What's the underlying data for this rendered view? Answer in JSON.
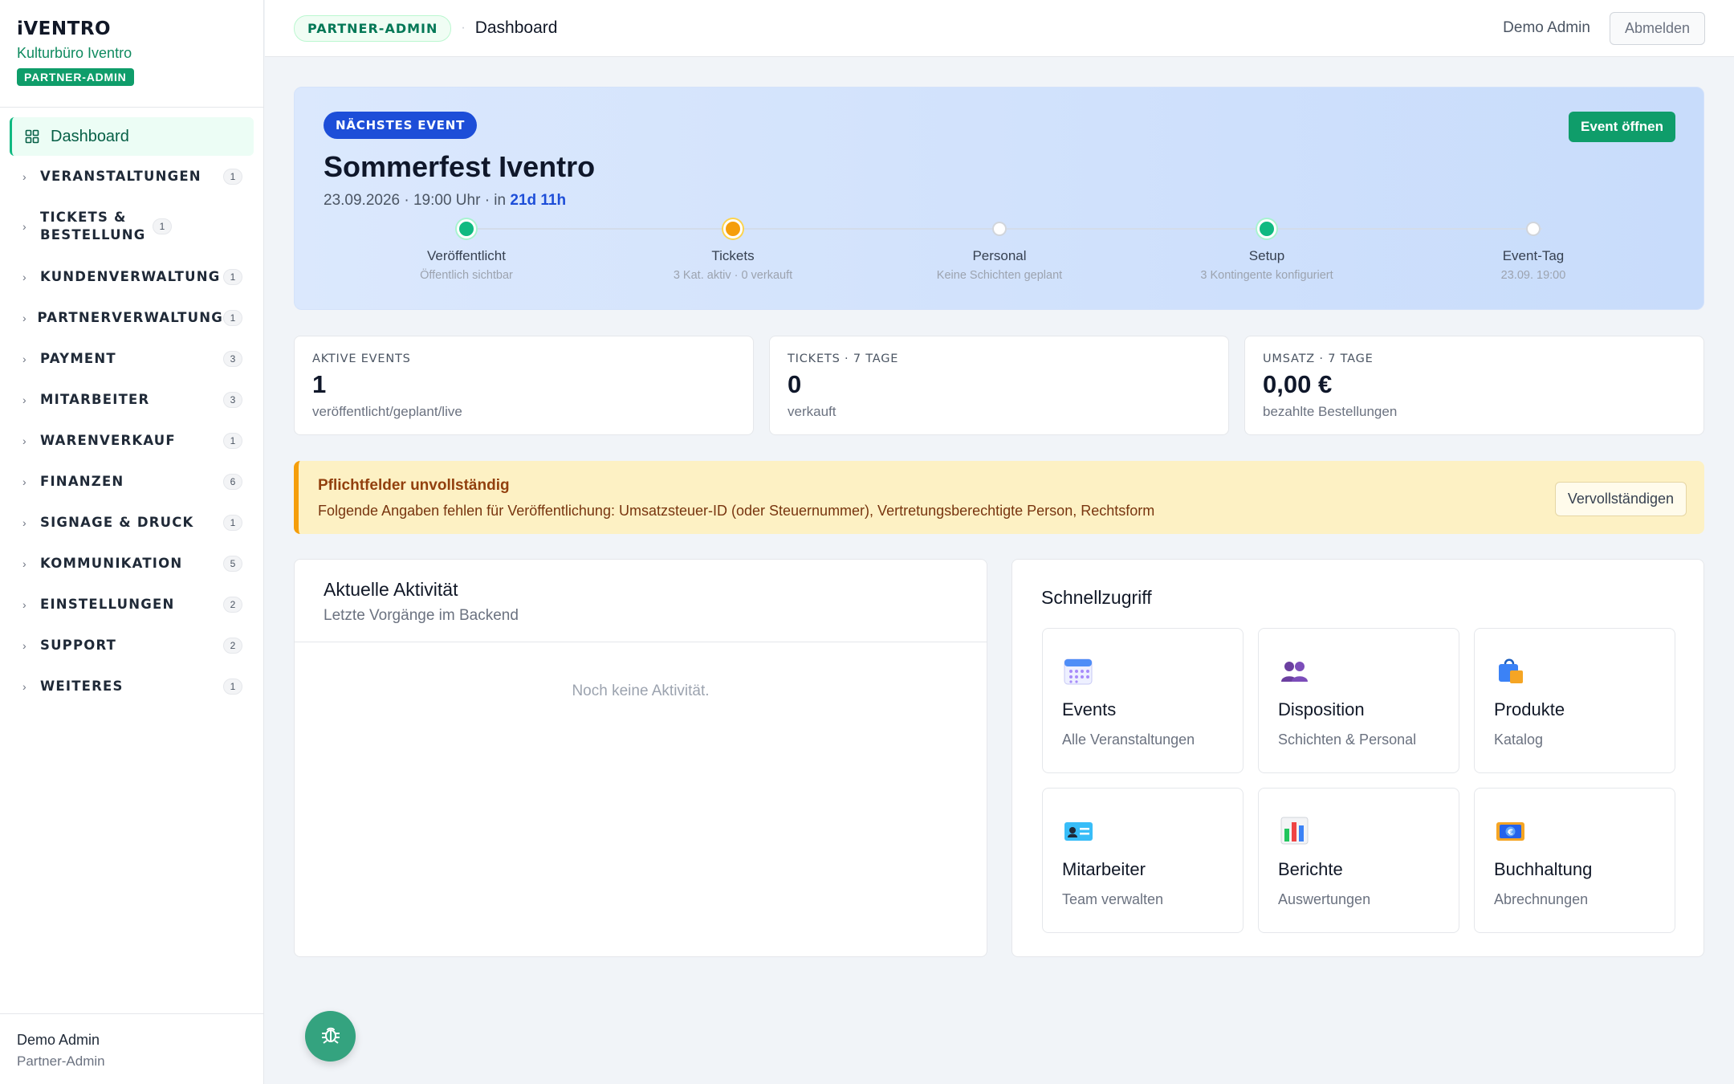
{
  "brand": {
    "logo": "iVENTRO",
    "org": "Kulturbüro Iventro",
    "role_badge": "PARTNER-ADMIN"
  },
  "nav": {
    "dashboard": {
      "label": "Dashboard",
      "icon": "grid-icon"
    },
    "groups": [
      {
        "label": "VERANSTALTUNGEN",
        "count": "1"
      },
      {
        "label": "TICKETS & BESTELLUNG",
        "count": "1"
      },
      {
        "label": "KUNDENVERWALTUNG",
        "count": "1"
      },
      {
        "label": "PARTNERVERWALTUNG",
        "count": "1"
      },
      {
        "label": "PAYMENT",
        "count": "3"
      },
      {
        "label": "MITARBEITER",
        "count": "3"
      },
      {
        "label": "WARENVERKAUF",
        "count": "1"
      },
      {
        "label": "FINANZEN",
        "count": "6"
      },
      {
        "label": "SIGNAGE & DRUCK",
        "count": "1"
      },
      {
        "label": "KOMMUNIKATION",
        "count": "5"
      },
      {
        "label": "EINSTELLUNGEN",
        "count": "2"
      },
      {
        "label": "SUPPORT",
        "count": "2"
      },
      {
        "label": "WEITERES",
        "count": "1"
      }
    ]
  },
  "sidebar_user": {
    "name": "Demo Admin",
    "role": "Partner-Admin"
  },
  "topbar": {
    "role_pill": "PARTNER-ADMIN",
    "separator": "·",
    "page_title": "Dashboard",
    "user": "Demo Admin",
    "logout": "Abmelden"
  },
  "hero": {
    "badge": "NÄCHSTES EVENT",
    "open_button": "Event öffnen",
    "title": "Sommerfest Iventro",
    "meta_prefix": "23.09.2026 · 19:00 Uhr · in ",
    "countdown": "21d 11h",
    "steps": [
      {
        "label": "Veröffentlicht",
        "sub": "Öffentlich sichtbar",
        "state": "done"
      },
      {
        "label": "Tickets",
        "sub": "3 Kat. aktiv · 0 verkauft",
        "state": "warning"
      },
      {
        "label": "Personal",
        "sub": "Keine Schichten geplant",
        "state": "pending"
      },
      {
        "label": "Setup",
        "sub": "3 Kontingente konfiguriert",
        "state": "done"
      },
      {
        "label": "Event-Tag",
        "sub": "23.09. 19:00",
        "state": "pending"
      }
    ]
  },
  "stats": [
    {
      "label": "AKTIVE EVENTS",
      "value": "1",
      "sub": "veröffentlicht/geplant/live"
    },
    {
      "label": "TICKETS · 7 TAGE",
      "value": "0",
      "sub": "verkauft"
    },
    {
      "label": "UMSATZ · 7 TAGE",
      "value": "0,00 €",
      "sub": "bezahlte Bestellungen"
    }
  ],
  "alert": {
    "title": "Pflichtfelder unvollständig",
    "text": "Folgende Angaben fehlen für Veröffentlichung: Umsatzsteuer-ID (oder Steuernummer), Vertretungsberechtigte Person, Rechtsform",
    "button": "Vervollständigen"
  },
  "activity": {
    "title": "Aktuelle Aktivität",
    "subtitle": "Letzte Vorgänge im Backend",
    "empty": "Noch keine Aktivität."
  },
  "quick": {
    "title": "Schnellzugriff",
    "tiles": [
      {
        "name": "Events",
        "sub": "Alle Veranstaltungen",
        "icon": "calendar-icon"
      },
      {
        "name": "Disposition",
        "sub": "Schichten & Personal",
        "icon": "people-icon"
      },
      {
        "name": "Produkte",
        "sub": "Katalog",
        "icon": "shopping-bag-icon"
      },
      {
        "name": "Mitarbeiter",
        "sub": "Team verwalten",
        "icon": "id-card-icon"
      },
      {
        "name": "Berichte",
        "sub": "Auswertungen",
        "icon": "bar-chart-icon"
      },
      {
        "name": "Buchhaltung",
        "sub": "Abrechnungen",
        "icon": "euro-banknote-icon"
      }
    ]
  },
  "colors": {
    "accent_green": "#0f9d6a",
    "accent_blue": "#1d4ed8",
    "warning": "#f59e0b"
  }
}
